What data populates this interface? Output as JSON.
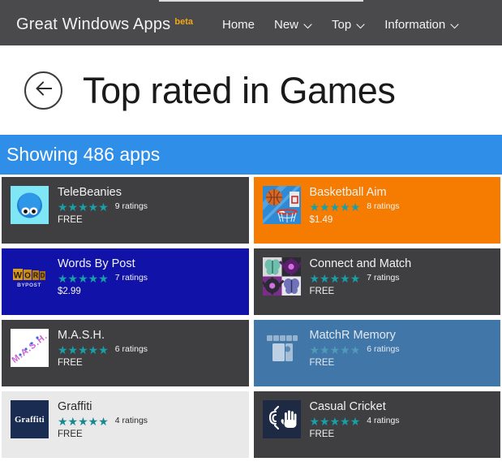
{
  "header": {
    "brand_name": "Great Windows Apps",
    "beta_label": "beta",
    "nav": [
      {
        "label": "Home",
        "has_chevron": false,
        "icon": ""
      },
      {
        "label": "New",
        "has_chevron": true,
        "icon": "chevron-down-icon"
      },
      {
        "label": "Top",
        "has_chevron": true,
        "icon": "chevron-down-icon"
      },
      {
        "label": "Information",
        "has_chevron": true,
        "icon": "chevron-down-icon"
      }
    ]
  },
  "page": {
    "back_icon": "back-arrow-icon",
    "title": "Top rated in Games",
    "banner_text": "Showing 486 apps"
  },
  "colors": {
    "appbar_bg": "#4a4a4d",
    "banner_bg": "#2f8fe8",
    "tile_dark": "#3f3f41",
    "tile_orange": "#f57c00",
    "tile_navy": "#1112a8",
    "tile_steel": "#4176a8",
    "tile_light": "#e9e9e9",
    "star_teal": "#17a0a8",
    "beta_amber": "#f0a818"
  },
  "apps": [
    {
      "name": "TeleBeanies",
      "stars": "★★★★★",
      "rating_count": "9 ratings",
      "price": "FREE",
      "tile_color": "dark",
      "text_style": "txt-light",
      "icon": "telebeanies-blob-icon"
    },
    {
      "name": "Basketball Aim",
      "stars": "★★★★★",
      "rating_count": "8 ratings",
      "price": "$1.49",
      "tile_color": "orange",
      "text_style": "txt-light",
      "icon": "basketball-hoop-icon"
    },
    {
      "name": "Words By Post",
      "stars": "★★★★★",
      "rating_count": "7 ratings",
      "price": "$2.99",
      "tile_color": "navy",
      "text_style": "txt-light",
      "icon": "words-by-post-tiles-icon"
    },
    {
      "name": "Connect and Match",
      "stars": "★★★★★",
      "rating_count": "7 ratings",
      "price": "FREE",
      "tile_color": "dark",
      "text_style": "txt-light",
      "icon": "butterfly-gear-grid-icon"
    },
    {
      "name": "M.A.S.H.",
      "stars": "★★★★★",
      "rating_count": "6 ratings",
      "price": "FREE",
      "tile_color": "dark",
      "text_style": "txt-light",
      "icon": "mash-script-icon"
    },
    {
      "name": "MatchR Memory",
      "stars": "★★★★★",
      "rating_count": "6 ratings",
      "price": "FREE",
      "tile_color": "steel",
      "text_style": "txt-faded",
      "icon": "memory-cards-icon"
    },
    {
      "name": "Graffiti",
      "stars": "★★★★★",
      "rating_count": "4 ratings",
      "price": "FREE",
      "tile_color": "light",
      "text_style": "txt-dark",
      "icon": "graffiti-wordmark-icon"
    },
    {
      "name": "Casual Cricket",
      "stars": "★★★★★",
      "rating_count": "4 ratings",
      "price": "FREE",
      "tile_color": "dark",
      "text_style": "txt-light",
      "icon": "cricket-hand-icon"
    }
  ]
}
